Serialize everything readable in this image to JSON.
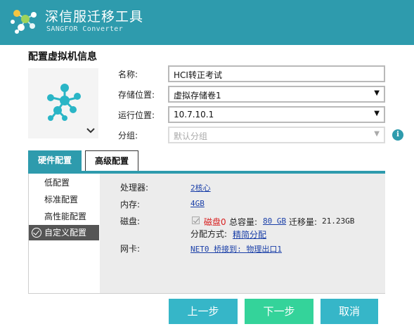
{
  "header": {
    "title": "深信服迁移工具",
    "subtitle": "SANGFOR Converter"
  },
  "section": {
    "title": "配置虚拟机信息"
  },
  "form": {
    "name_label": "名称:",
    "name_value": "HCI转正考试",
    "storage_label": "存储位置:",
    "storage_value": "虚拟存储卷1",
    "run_label": "运行位置:",
    "run_value": "10.7.10.1",
    "group_label": "分组:",
    "group_placeholder": "默认分组",
    "info_icon": "i"
  },
  "tabs": [
    {
      "label": "硬件配置",
      "active": true
    },
    {
      "label": "高级配置",
      "active": false
    }
  ],
  "presets": [
    {
      "label": "低配置",
      "selected": false
    },
    {
      "label": "标准配置",
      "selected": false
    },
    {
      "label": "高性能配置",
      "selected": false
    },
    {
      "label": "自定义配置",
      "selected": true
    }
  ],
  "specs": {
    "cpu_label": "处理器:",
    "cpu_value": "2核心",
    "mem_label": "内存:",
    "mem_value": "4GB",
    "disk_label": "磁盘:",
    "disk_name": "磁盘0",
    "disk_total_label": "总容量:",
    "disk_total_value": "80 GB",
    "disk_migrate_label": "迁移量:",
    "disk_migrate_value": "21.23GB",
    "alloc_label": "分配方式:",
    "alloc_value": "精简分配",
    "nic_label": "网卡:",
    "nic_value": "NET0 桥接到: 物理出口1"
  },
  "buttons": {
    "prev": "上一步",
    "next": "下一步",
    "cancel": "取消"
  },
  "colors": {
    "accent": "#2e9bad",
    "button_primary": "#36b6c8",
    "button_next": "#34d39a",
    "link": "#1a3fa8",
    "disk_name": "#d81e1e"
  },
  "icons": {
    "logo": "sangfor-logo-icon",
    "vm": "vm-molecule-icon",
    "chevron": "chevron-down-icon",
    "info": "info-icon",
    "selected": "check-circle-icon",
    "dropdown": "dropdown-arrow-icon"
  }
}
